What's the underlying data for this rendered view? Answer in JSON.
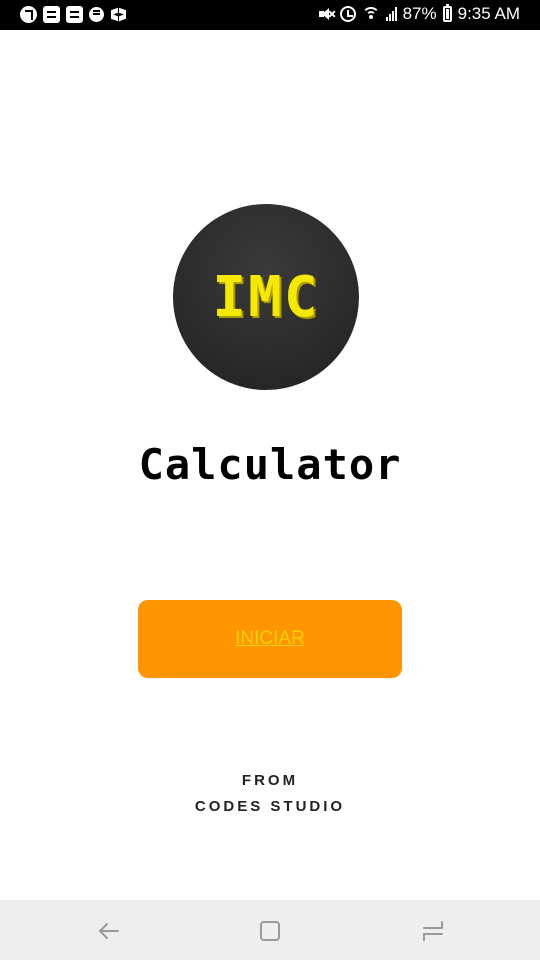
{
  "status_bar": {
    "left_icons": [
      "music-icon",
      "document-icon",
      "document-icon",
      "message-icon",
      "dropbox-icon"
    ],
    "battery": "87%",
    "time": "9:35 AM"
  },
  "logo": {
    "text": "IMC",
    "colors": {
      "circle": "#2b2b2b",
      "text": "#f6e800"
    }
  },
  "app": {
    "title": "Calculator"
  },
  "start_button": {
    "label": "INICIAR",
    "color": "#ff9500",
    "label_color": "#ffd200"
  },
  "credit": {
    "line1": "FROM",
    "line2": "CODES STUDIO"
  },
  "nav_bar": {
    "buttons": [
      "back-icon",
      "home-icon",
      "recent-apps-icon"
    ]
  }
}
